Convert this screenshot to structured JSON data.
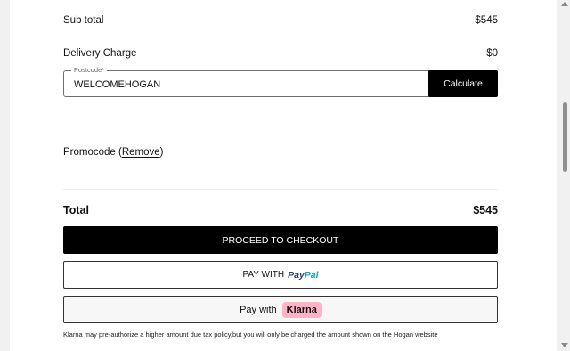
{
  "summary": {
    "subtotal_label": "Sub total",
    "subtotal_value": "$545",
    "delivery_label": "Delivery Charge",
    "delivery_value": "$0"
  },
  "postcode": {
    "legend": "Postcode*",
    "value": "WELCOMEHOGAN",
    "calculate_label": "Calculate"
  },
  "promo": {
    "label": "Promocode (",
    "remove_label": "Remove",
    "close": ")"
  },
  "total": {
    "label": "Total",
    "value": "$545"
  },
  "buttons": {
    "checkout_label": "PROCEED TO CHECKOUT",
    "paypal_prefix": "PAY WITH",
    "paypal_logo_part1": "Pay",
    "paypal_logo_part2": "Pal",
    "klarna_prefix": "Pay with",
    "klarna_logo": "Klarna"
  },
  "note": "Klarna may pre-authorize a higher amount due tax policy,but you will only be charged the amount shown on the Hogan website",
  "colors": {
    "klarna_pink": "#ffb3c7",
    "paypal_dark_blue": "#253b80",
    "paypal_light_blue": "#179bd7"
  }
}
